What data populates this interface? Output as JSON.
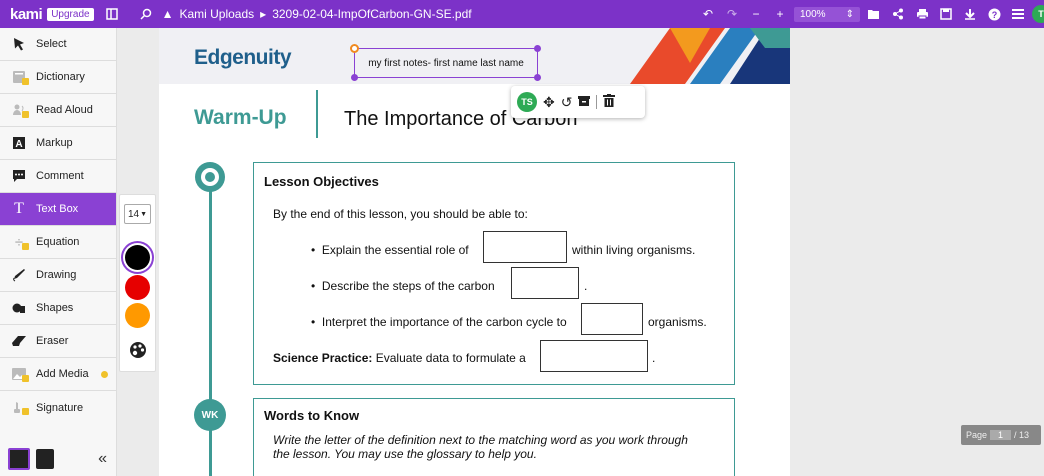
{
  "topbar": {
    "logo": "kami",
    "upgrade_label": "Upgrade",
    "breadcrumb_folder": "Kami Uploads",
    "file_name": "3209-02-04-ImpOfCarbon-GN-SE.pdf",
    "zoom": "100%",
    "avatar_initial": "T"
  },
  "sidebar": {
    "tools": [
      {
        "label": "Select",
        "icon": "cursor-icon"
      },
      {
        "label": "Dictionary",
        "icon": "book-icon"
      },
      {
        "label": "Read Aloud",
        "icon": "speaker-icon"
      },
      {
        "label": "Markup",
        "icon": "markup-icon"
      },
      {
        "label": "Comment",
        "icon": "comment-icon"
      },
      {
        "label": "Text Box",
        "icon": "text-icon"
      },
      {
        "label": "Equation",
        "icon": "divide-icon"
      },
      {
        "label": "Drawing",
        "icon": "pen-icon"
      },
      {
        "label": "Shapes",
        "icon": "shapes-icon"
      },
      {
        "label": "Eraser",
        "icon": "eraser-icon"
      },
      {
        "label": "Add Media",
        "icon": "image-icon"
      },
      {
        "label": "Signature",
        "icon": "signature-icon"
      }
    ],
    "collapse_glyph": "«"
  },
  "subpanel": {
    "font_size": "14",
    "colors": [
      "#000000",
      "#e60000",
      "#ff9900"
    ]
  },
  "document": {
    "brand": "Edgenuity",
    "textbox_text": "my first notes- first name last name",
    "avatar_initials": "TS",
    "warmup_label": "Warm-Up",
    "page_title": "The Importance of Carbon",
    "objectives_heading": "Lesson Objectives",
    "objectives_intro": "By the end of this lesson, you should be able to:",
    "bullet1_before": "Explain the essential role of",
    "bullet1_after": "within living organisms.",
    "bullet2_before": "Describe the steps of the carbon",
    "bullet2_after": ".",
    "bullet3_before": "Interpret the importance of the carbon cycle to",
    "bullet3_after": "organisms.",
    "practice_bold": "Science Practice:",
    "practice_text": "Evaluate data to formulate a",
    "practice_after": ".",
    "words_heading": "Words to Know",
    "words_line1": "Write the letter of the definition next to the matching word as you work through",
    "words_line2": "the lesson. You may use the glossary to help you.",
    "wk_badge": "WK"
  },
  "pager": {
    "label": "Page",
    "current": "1",
    "total": "/ 13"
  }
}
